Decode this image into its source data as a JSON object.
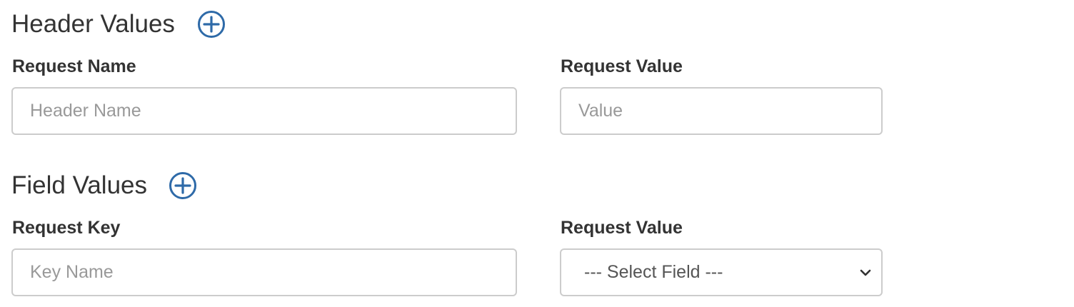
{
  "header_section": {
    "title": "Header Values",
    "add_icon": "plus-circle-icon",
    "name_label": "Request Name",
    "name_placeholder": "Header Name",
    "name_value": "",
    "value_label": "Request Value",
    "value_placeholder": "Value",
    "value_value": ""
  },
  "field_section": {
    "title": "Field Values",
    "add_icon": "plus-circle-icon",
    "key_label": "Request Key",
    "key_placeholder": "Key Name",
    "key_value": "",
    "value_label": "Request Value",
    "select_selected": "--- Select Field ---",
    "select_icon": "chevron-down-icon"
  },
  "colors": {
    "accent": "#2e6aa8",
    "text": "#333333",
    "border": "#cccccc",
    "placeholder": "#999999"
  }
}
